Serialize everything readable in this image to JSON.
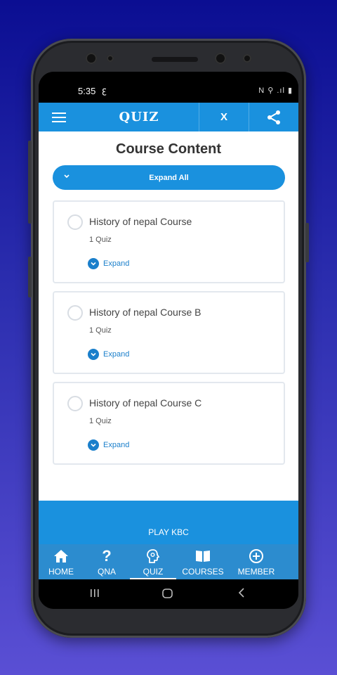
{
  "status_bar": {
    "time": "5:35",
    "left_icon": "ꜫ",
    "right_icons": "N ⚲ .ıl ▮"
  },
  "app_bar": {
    "title": "QUIZ",
    "close_label": "X",
    "menu_icon": "hamburger-icon",
    "share_icon": "share-icon"
  },
  "page": {
    "heading": "Course Content",
    "expand_all_label": "Expand All"
  },
  "courses": [
    {
      "title": "History of nepal Course",
      "count": "1 Quiz",
      "expand_label": "Expand"
    },
    {
      "title": "History of nepal Course B",
      "count": "1 Quiz",
      "expand_label": "Expand"
    },
    {
      "title": "History of nepal Course C",
      "count": "1 Quiz",
      "expand_label": "Expand"
    }
  ],
  "play_bar": {
    "label": "PLAY KBC"
  },
  "bottom_nav": [
    {
      "label": "HOME",
      "icon": "home-icon"
    },
    {
      "label": "QNA",
      "icon": "question-icon"
    },
    {
      "label": "QUIZ",
      "icon": "brain-icon",
      "active": true
    },
    {
      "label": "COURSES",
      "icon": "book-icon"
    },
    {
      "label": "MEMBER",
      "icon": "plus-circle-icon"
    }
  ],
  "colors": {
    "primary": "#1a91de",
    "nav": "#2c8ccf",
    "link": "#1a7fcb",
    "background_top": "#0b0e92",
    "background_bottom": "#5a4fd4"
  }
}
